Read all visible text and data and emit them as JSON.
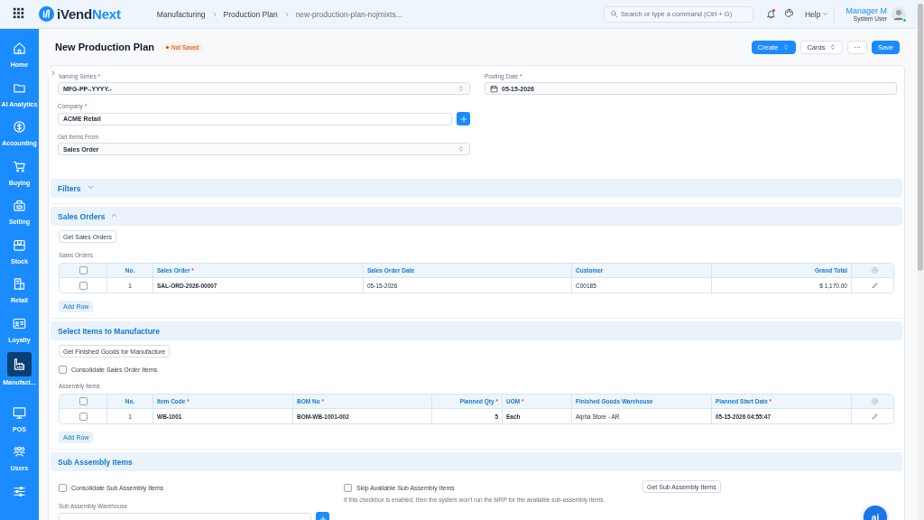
{
  "topbar": {
    "logo_main": "iVend",
    "logo_accent": "Next",
    "breadcrumbs": [
      {
        "label": "Manufacturing",
        "current": false
      },
      {
        "label": "Production Plan",
        "current": false
      },
      {
        "label": "new-production-plan-nojmixts...",
        "current": true
      }
    ],
    "search": {
      "placeholder": "Search or type a command (Ctrl + G)"
    },
    "help": "Help",
    "user": {
      "name": "Manager M",
      "role": "System User",
      "online": true
    }
  },
  "sidebar": {
    "items": [
      {
        "kind": "home",
        "label": "Home",
        "selected": false
      },
      {
        "kind": "folder",
        "label": "AI Analytics",
        "selected": false
      },
      {
        "kind": "dollar",
        "label": "Accounting",
        "selected": false
      },
      {
        "kind": "cart",
        "label": "Buying",
        "selected": false
      },
      {
        "kind": "bag",
        "label": "Selling",
        "selected": false
      },
      {
        "kind": "box",
        "label": "Stock",
        "selected": false
      },
      {
        "kind": "register",
        "label": "Retail",
        "selected": false
      },
      {
        "kind": "card",
        "label": "Loyalty",
        "selected": false
      },
      {
        "kind": "factory",
        "label": "Manufact...",
        "selected": true
      },
      {
        "kind": "monitor",
        "label": "POS",
        "selected": false
      },
      {
        "kind": "users",
        "label": "Users",
        "selected": false
      },
      {
        "kind": "sliders",
        "selected": false
      }
    ]
  },
  "page": {
    "title": "New Production Plan",
    "status": "Not Saved",
    "buttons": [
      {
        "label": "Create",
        "kind": "primary",
        "dropdown": true
      },
      {
        "label": "Cards",
        "kind": "default",
        "dropdown": true
      },
      {
        "label": "···",
        "kind": "default",
        "dropdown": false
      },
      {
        "label": "Save",
        "kind": "primary",
        "dropdown": false
      }
    ]
  },
  "form": {
    "left": [
      {
        "kind": "select",
        "label": "Naming Series",
        "mark": "*",
        "value": "MFG-PP-.YYYY.-"
      },
      {
        "kind": "link",
        "label": "Company",
        "mark": "*",
        "value": "ACME Retail"
      },
      {
        "kind": "select",
        "label": "Get Items From",
        "value": "Sales Order"
      }
    ],
    "right": [
      {
        "kind": "date",
        "label": "Posting Date",
        "mark": "*",
        "value": "05-15-2026"
      }
    ]
  },
  "sections": [
    {
      "kind": "filters",
      "title": "Filters",
      "expanded": false
    },
    {
      "kind": "sales_orders",
      "title": "Sales Orders",
      "expanded": true,
      "button": "Get Sales Orders",
      "table": {
        "label": "Sales Orders",
        "header_checked": false,
        "columns": [
          {
            "label": "No."
          },
          {
            "label": "Sales Order",
            "mark": "*",
            "bold": true
          },
          {
            "label": "Sales Order Date"
          },
          {
            "label": "Customer"
          },
          {
            "label": "Grand Total"
          }
        ],
        "rows": [
          {
            "checked": false,
            "cells": [
              "1",
              "SAL-ORD-2026-00007",
              "05-15-2026",
              "C00185",
              "$ 1,170.00"
            ]
          }
        ],
        "add_row": "Add Row"
      }
    },
    {
      "kind": "items",
      "title": "Select Items to Manufacture",
      "button": "Get Finished Goods for Manufacture",
      "checkbox": {
        "label": "Consolidate Sales Order Items",
        "checked": false
      },
      "table": {
        "label": "Assembly Items",
        "header_checked": false,
        "columns": [
          {
            "label": "No."
          },
          {
            "label": "Item Code",
            "mark": "*",
            "bold": true
          },
          {
            "label": "BOM No",
            "mark": "*",
            "bold": true
          },
          {
            "label": "Planned Qty",
            "mark": "*",
            "bold": true
          },
          {
            "label": "UOM",
            "mark": "*",
            "bold": true
          },
          {
            "label": "Finished Goods Warehouse"
          },
          {
            "label": "Planned Start Date",
            "mark": "*",
            "bold": true
          }
        ],
        "rows": [
          {
            "checked": false,
            "cells": [
              "1",
              "WB-1001",
              "BOM-WB-1001-002",
              "5",
              "Each",
              "Alpha Store - AR",
              "05-15-2026 04:55:47"
            ]
          }
        ],
        "add_row": "Add Row"
      }
    },
    {
      "kind": "sub_assembly",
      "title": "Sub Assembly Items",
      "checkboxes": [
        {
          "label": "Consolidate Sub Assembly Items",
          "checked": false
        },
        {
          "label": "Skip Available Sub Assembly Items",
          "checked": false
        }
      ],
      "field": {
        "label": "Sub Assembly Warehouse"
      },
      "description": "If this checkbox is enabled, then the system won't run the MRP for the available sub-assembly items.",
      "button": "Get Sub Assembly Items"
    }
  ],
  "ai_button": "ai"
}
